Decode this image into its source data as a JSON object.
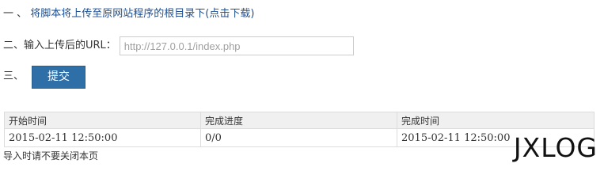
{
  "steps": {
    "step1": {
      "prefix": "一 、",
      "text": "将脚本将上传至原网站程序的根目录下(点击下载)"
    },
    "step2": {
      "label": "二、输入上传后的URL：",
      "url_value": "",
      "url_placeholder": "http://127.0.0.1/index.php"
    },
    "step3": {
      "label": "三、",
      "submit_label": "提交"
    }
  },
  "table": {
    "headers": [
      "开始时间",
      "完成进度",
      "完成时间"
    ],
    "rows": [
      [
        "2015-02-11 12:50:00",
        "0/0",
        "2015-02-11 12:50:00"
      ]
    ]
  },
  "notice": "导入时请不要关闭本页",
  "watermark": "JXLOG"
}
